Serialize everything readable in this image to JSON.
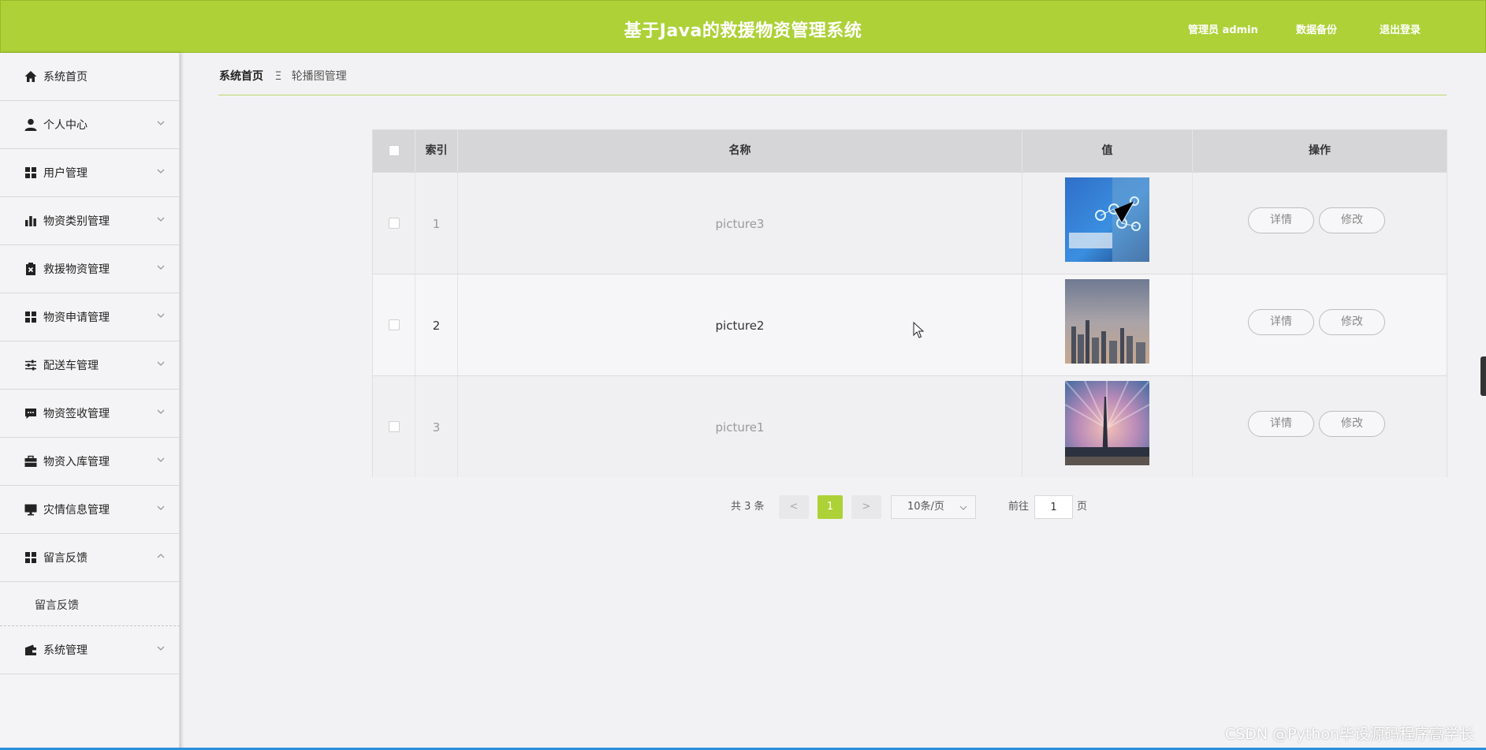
{
  "header": {
    "title": "基于Java的救援物资管理系统",
    "admin_label": "管理员 admin",
    "backup_label": "数据备份",
    "logout_label": "退出登录"
  },
  "sidebar": {
    "items": [
      {
        "label": "系统首页",
        "icon": "home-icon",
        "expandable": false
      },
      {
        "label": "个人中心",
        "icon": "user-icon",
        "expandable": true
      },
      {
        "label": "用户管理",
        "icon": "grid-icon",
        "expandable": true
      },
      {
        "label": "物资类别管理",
        "icon": "bar-chart-icon",
        "expandable": true
      },
      {
        "label": "救援物资管理",
        "icon": "clipboard-x-icon",
        "expandable": true
      },
      {
        "label": "物资申请管理",
        "icon": "grid-icon",
        "expandable": true
      },
      {
        "label": "配送车管理",
        "icon": "sliders-icon",
        "expandable": true
      },
      {
        "label": "物资签收管理",
        "icon": "comment-icon",
        "expandable": true
      },
      {
        "label": "物资入库管理",
        "icon": "briefcase-icon",
        "expandable": true
      },
      {
        "label": "灾情信息管理",
        "icon": "monitor-icon",
        "expandable": true
      },
      {
        "label": "留言反馈",
        "icon": "grid-icon",
        "expandable": true,
        "expanded": true
      },
      {
        "label": "系统管理",
        "icon": "wallet-icon",
        "expandable": true
      }
    ],
    "subitem": "留言反馈"
  },
  "breadcrumb": {
    "home": "系统首页",
    "separator": "Ξ",
    "current": "轮播图管理"
  },
  "table": {
    "columns": [
      "索引",
      "名称",
      "值",
      "操作"
    ],
    "rows": [
      {
        "index": "1",
        "name": "picture3",
        "image": "medical-tech-image",
        "detail": "详情",
        "edit": "修改"
      },
      {
        "index": "2",
        "name": "picture2",
        "image": "city-skyline-image",
        "detail": "详情",
        "edit": "修改"
      },
      {
        "index": "3",
        "name": "picture1",
        "image": "tower-sunset-image",
        "detail": "详情",
        "edit": "修改"
      }
    ]
  },
  "pagination": {
    "total": "共 3 条",
    "prev": "<",
    "current_page": "1",
    "next": ">",
    "page_size": "10条/页",
    "goto_label": "前往",
    "goto_value": "1",
    "page_suffix": "页"
  },
  "watermark": "CSDN @Python毕设源码程序高学长",
  "colors": {
    "accent": "#add137",
    "header_bg": "#add137",
    "table_header_bg": "#d6d6d9"
  }
}
